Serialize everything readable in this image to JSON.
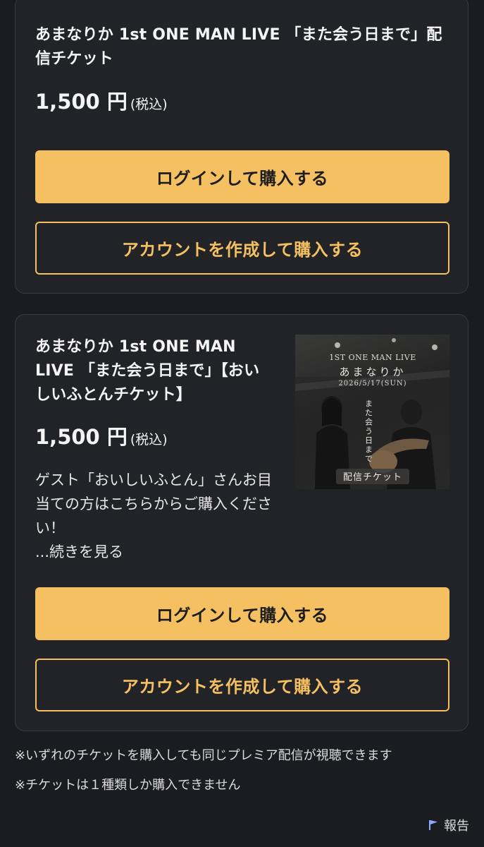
{
  "tickets": [
    {
      "title": "あまなりか 1st ONE MAN LIVE 「また会う日まで」配信チケット",
      "price": "1,500 円",
      "tax_note": "(税込)",
      "login_button": "ログインして購入する",
      "signup_button": "アカウントを作成して購入する"
    },
    {
      "title": "あまなりか 1st ONE MAN LIVE 「また会う日まで」【おいしいふとんチケット】",
      "price": "1,500 円",
      "tax_note": "(税込)",
      "description": "ゲスト「おいしいふとん」さんお目当ての方はこちらからご購入ください！",
      "read_more": "...続きを見る",
      "thumbnail": {
        "line1": "1ST ONE MAN LIVE",
        "line2": "あまなりか",
        "line3": "2026/5/17(SUN)",
        "vertical_text": "また会う日まで",
        "badge": "配信チケット"
      },
      "login_button": "ログインして購入する",
      "signup_button": "アカウントを作成して購入する"
    }
  ],
  "notes": [
    "※いずれのチケットを購入しても同じプレミア配信が視聴できます",
    "※チケットは１種類しか購入できません"
  ],
  "report_label": "報告",
  "colors": {
    "background": "#1b1c20",
    "card": "#222327",
    "accent": "#f4c062",
    "flag_icon": "#8fa8ff"
  },
  "icons": {
    "report": "flag-icon"
  }
}
